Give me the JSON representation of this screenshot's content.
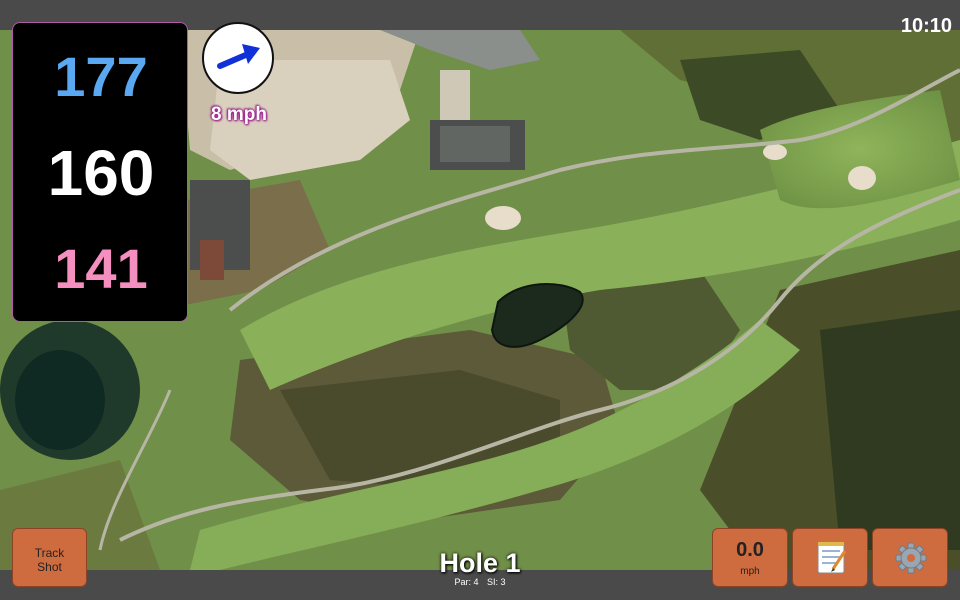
{
  "status": {
    "time": "10:10"
  },
  "distances": {
    "back": "177",
    "center": "160",
    "front": "141"
  },
  "wind": {
    "speed_label": "8 mph",
    "direction_icon": "arrow-icon"
  },
  "hole": {
    "title": "Hole 1",
    "par_label": "Par: 4",
    "si_label": "SI: 3"
  },
  "buttons": {
    "track_shot_line1": "Track",
    "track_shot_line2": "Shot",
    "speed_value": "0.0",
    "speed_unit": "mph",
    "notes_icon": "notepad-icon",
    "settings_icon": "gear-icon"
  },
  "colors": {
    "back_distance": "#5ba8f2",
    "center_distance": "#ffffff",
    "front_distance": "#f48fbf",
    "button": "#cf6c3f",
    "wind_text_glow": "#9b1a8a"
  }
}
